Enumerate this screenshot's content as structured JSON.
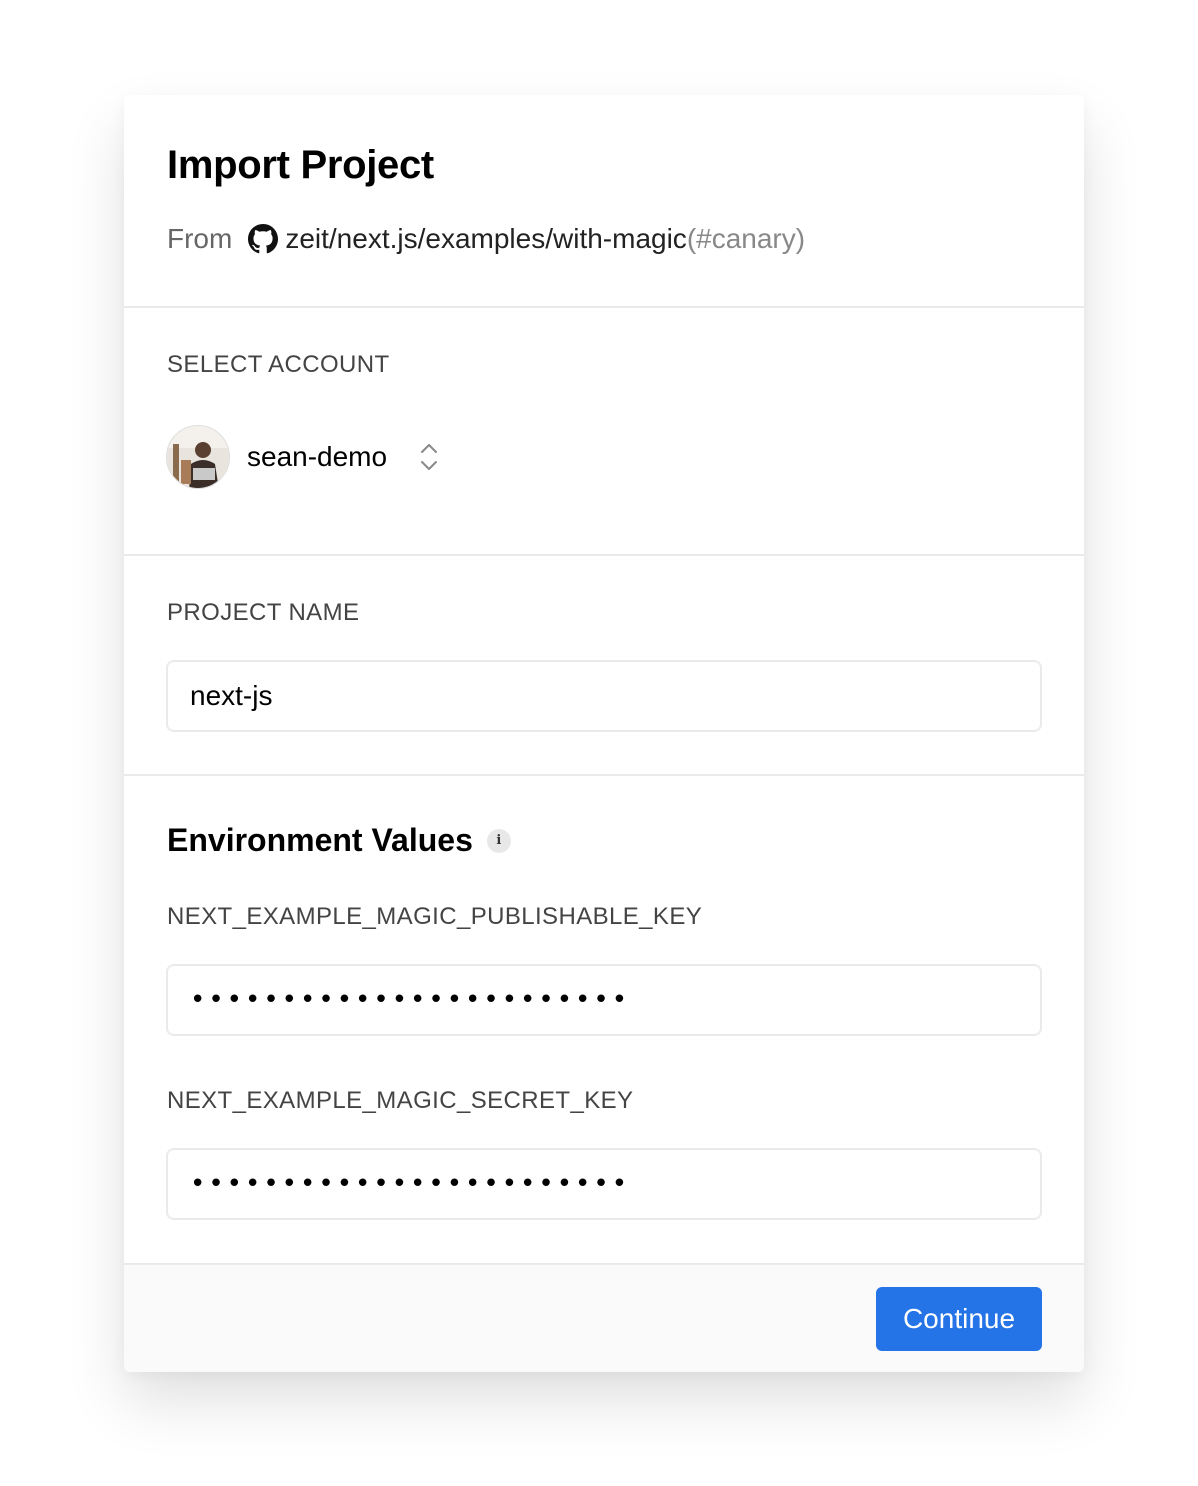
{
  "header": {
    "title": "Import Project",
    "from_label": "From",
    "repo": "zeit/next.js/examples/with-magic",
    "branch": "(#canary)"
  },
  "account": {
    "label": "SELECT ACCOUNT",
    "name": "sean-demo"
  },
  "project": {
    "label": "PROJECT NAME",
    "value": "next-js"
  },
  "environment": {
    "title": "Environment Values",
    "info_icon": "i",
    "vars": [
      {
        "key": "NEXT_EXAMPLE_MAGIC_PUBLISHABLE_KEY",
        "value": "••••••••••••••••••••••••"
      },
      {
        "key": "NEXT_EXAMPLE_MAGIC_SECRET_KEY",
        "value": "••••••••••••••••••••••••"
      }
    ]
  },
  "footer": {
    "continue_label": "Continue"
  },
  "colors": {
    "accent": "#2474e8",
    "divider": "#eaeaea",
    "footer_bg": "#fafafa"
  },
  "icons": {
    "repo_provider": "github-icon",
    "account_switch": "chevron-up-down-icon",
    "info": "info-icon"
  }
}
